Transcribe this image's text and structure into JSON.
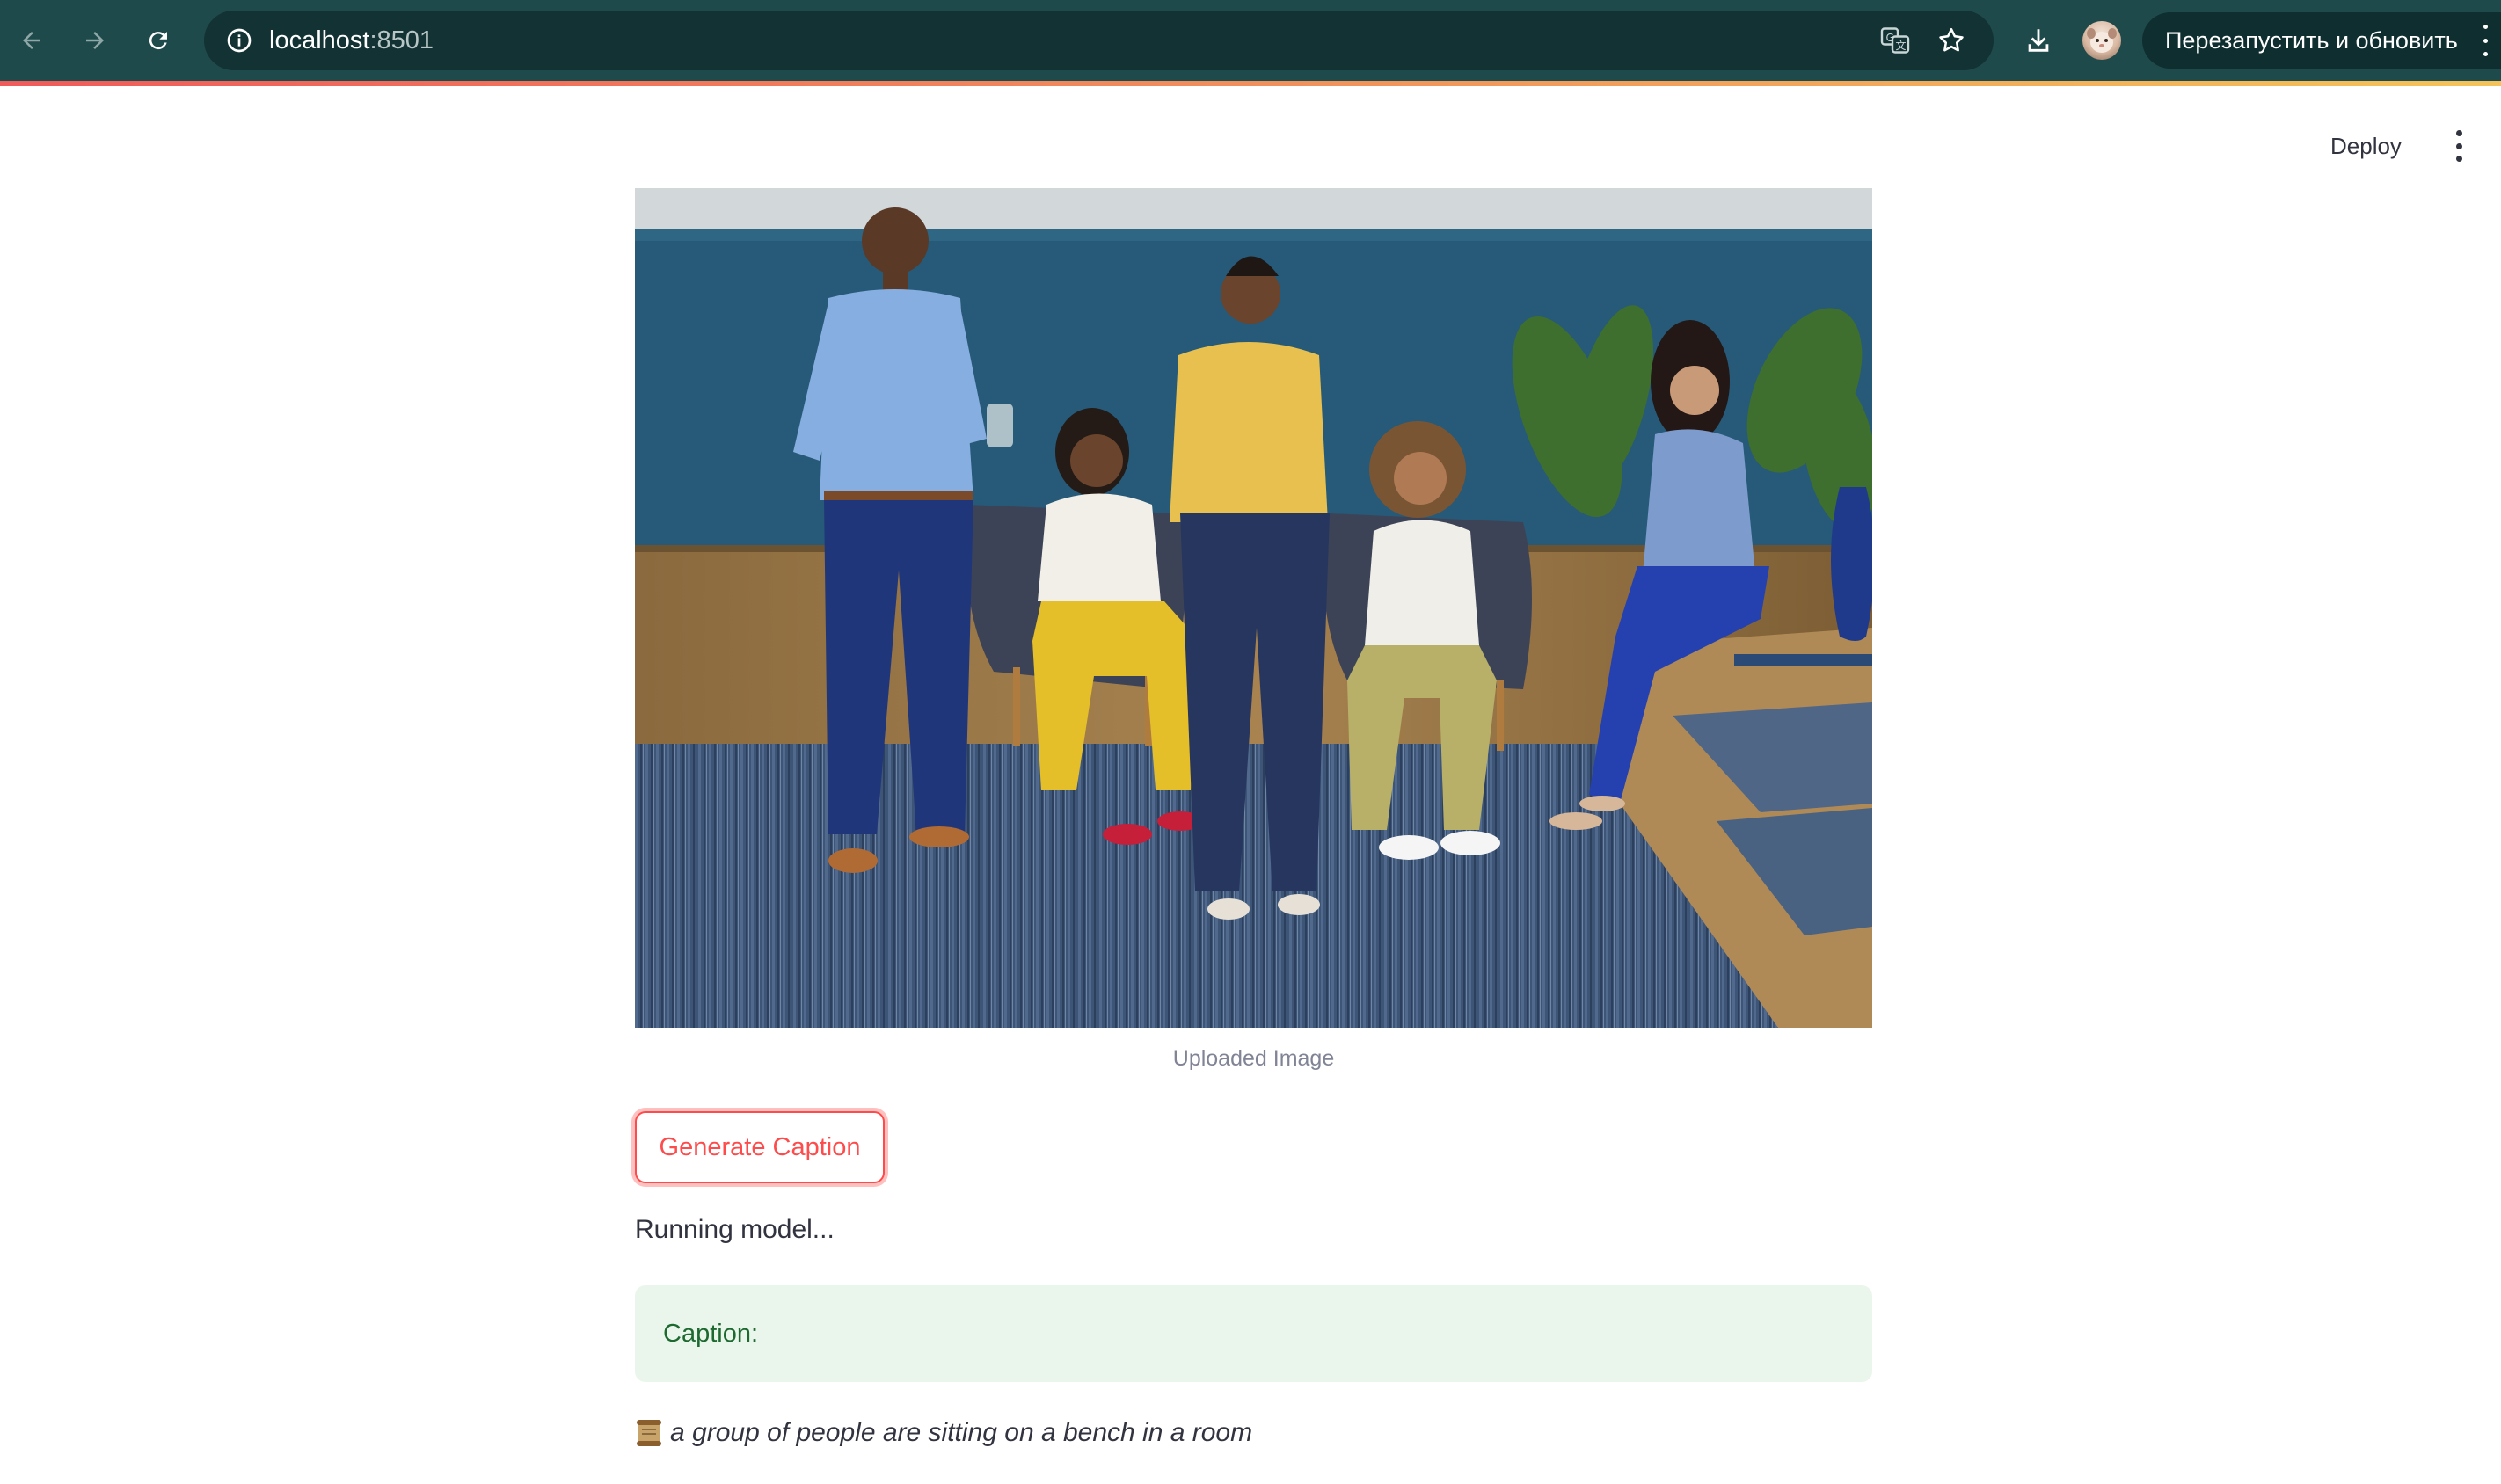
{
  "browser": {
    "url_host": "localhost",
    "url_port": ":8501",
    "relaunch_label": "Перезапустить и обновить",
    "icons": {
      "back": "arrow-left-icon",
      "forward": "arrow-right-icon",
      "reload": "reload-icon",
      "site_info": "info-icon",
      "translate": "translate-icon",
      "bookmark": "star-icon",
      "download": "download-icon",
      "profile": "avatar",
      "menu": "more-vertical-icon"
    },
    "colors": {
      "toolbar": "#1f4a4c",
      "omnibox": "#123234"
    }
  },
  "header": {
    "deploy_label": "Deploy",
    "menu_icon": "more-vertical-icon"
  },
  "main": {
    "image_caption": "Uploaded Image",
    "generate_button_label": "Generate Caption",
    "status_text": "Running model...",
    "success_label": "Caption:",
    "caption_text": "a group of people are sitting on a bench in a room",
    "caption_icon": "scroll-icon",
    "colors": {
      "primary": "#ff4b4b",
      "success_bg": "#eaf6ec",
      "success_text": "#1d6a30"
    }
  }
}
